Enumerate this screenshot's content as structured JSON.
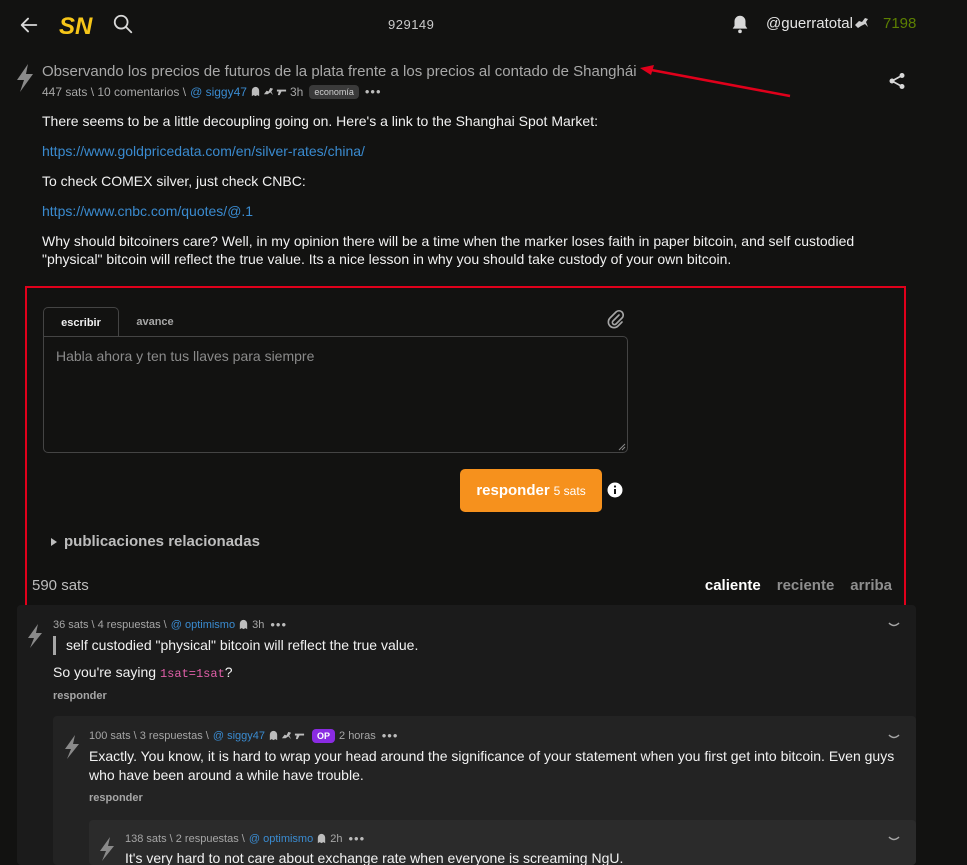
{
  "header": {
    "block_height": "929149",
    "user_handle": "@guerratotal",
    "user_sats": "7198"
  },
  "post": {
    "title": "Observando los precios de futuros de la plata frente a los precios al contado de Shanghái",
    "meta_stats": "447 sats \\ 10 comentarios \\",
    "author": "@ siggy47",
    "age": "3h",
    "tag": "economía",
    "body": {
      "p1": "There seems to be a little decoupling going on. Here's a link to the Shanghai Spot Market:",
      "link1": "https://www.goldpricedata.com/en/silver-rates/china/",
      "p2": "To check COMEX silver, just check CNBC:",
      "link2": "https://www.cnbc.com/quotes/@.1",
      "p3": "Why should bitcoiners care? Well, in my opinion there will be a time when the marker loses faith in paper bitcoin, and self custodied \"physical\" bitcoin will reflect the true value. Its a nice lesson in why you should take custody of your own bitcoin."
    }
  },
  "reply_form": {
    "tab_write": "escribir",
    "tab_preview": "avance",
    "placeholder": "Habla ahora y ten tus llaves para siempre",
    "button_label": "responder",
    "button_cost": "5 sats",
    "related_label": "publicaciones relacionadas"
  },
  "comments_bar": {
    "total_sats": "590 sats",
    "sort_hot": "caliente",
    "sort_recent": "reciente",
    "sort_top": "arriba"
  },
  "comments": [
    {
      "meta_stats": "36 sats \\ 4 respuestas \\",
      "author": "@ optimismo",
      "age": "3h",
      "quote": "self custodied \"physical\" bitcoin will reflect the true value.",
      "text_before_code": "So you're saying ",
      "code": "1sat=1sat",
      "text_after_code": "?",
      "reply_label": "responder"
    },
    {
      "meta_stats": "100 sats \\ 3 respuestas \\",
      "author": "@ siggy47",
      "op_badge": "OP",
      "age": "2 horas",
      "text": "Exactly. You know, it is hard to wrap your head around the significance of your statement when you first get into bitcoin. Even guys who have been around a while have trouble.",
      "reply_label": "responder"
    },
    {
      "meta_stats": "138 sats \\ 2 respuestas \\",
      "author": "@ optimismo",
      "age": "2h",
      "text": "It's very hard to not care about exchange rate when everyone is screaming NgU."
    }
  ],
  "colors": {
    "background": "#121211",
    "accent_orange": "#f6911d",
    "link_blue": "#3a8bd0",
    "sats_green": "#5c8001",
    "annotation_red": "#e0001b"
  }
}
